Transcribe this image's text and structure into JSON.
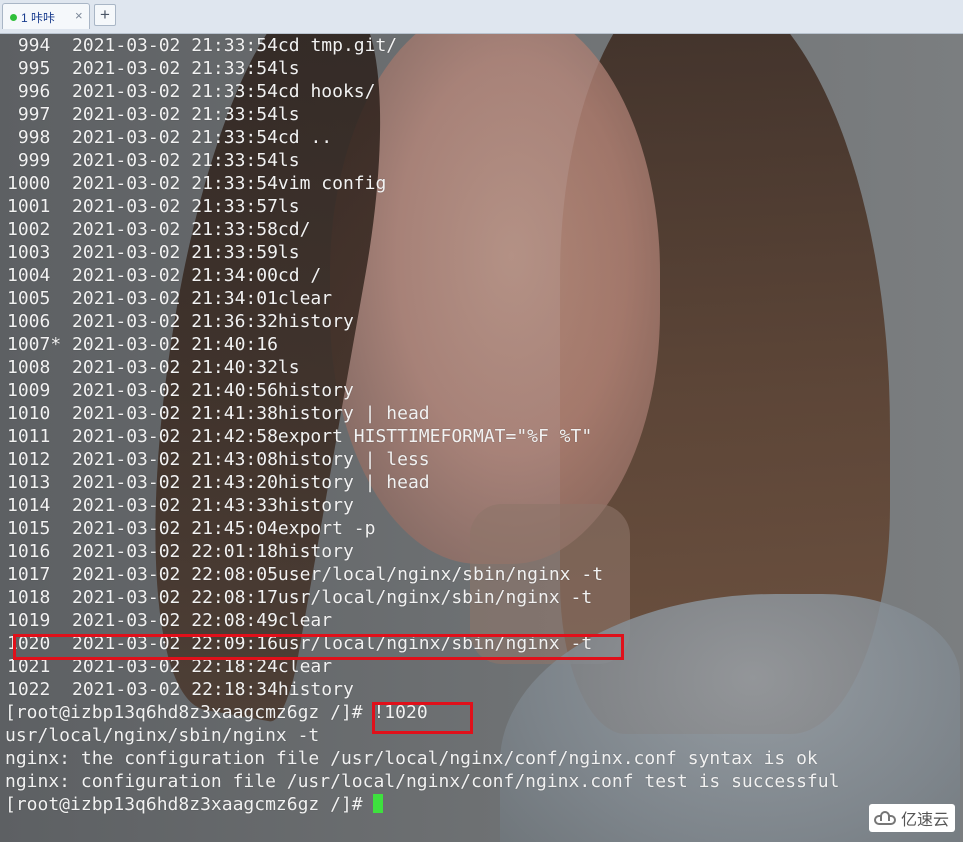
{
  "tab": {
    "label": "1 咔咔",
    "close": "×",
    "dot_color": "#2fbf3a"
  },
  "new_tab": "+",
  "history": [
    "994  2021-03-02 21:33:54cd tmp.git/",
    "995  2021-03-02 21:33:54ls",
    "996  2021-03-02 21:33:54cd hooks/",
    "997  2021-03-02 21:33:54ls",
    "998  2021-03-02 21:33:54cd ..",
    "999  2021-03-02 21:33:54ls",
    "1000  2021-03-02 21:33:54vim config",
    "1001  2021-03-02 21:33:57ls",
    "1002  2021-03-02 21:33:58cd/",
    "1003  2021-03-02 21:33:59ls",
    "1004  2021-03-02 21:34:00cd /",
    "1005  2021-03-02 21:34:01clear",
    "1006  2021-03-02 21:36:32history",
    "1007* 2021-03-02 21:40:16",
    "1008  2021-03-02 21:40:32ls",
    "1009  2021-03-02 21:40:56history",
    "1010  2021-03-02 21:41:38history | head",
    "1011  2021-03-02 21:42:58export HISTTIMEFORMAT=\"%F %T\"",
    "1012  2021-03-02 21:43:08history | less",
    "1013  2021-03-02 21:43:20history | head",
    "1014  2021-03-02 21:43:33history",
    "1015  2021-03-02 21:45:04export -p",
    "1016  2021-03-02 22:01:18history",
    "1017  2021-03-02 22:08:05user/local/nginx/sbin/nginx -t",
    "1018  2021-03-02 22:08:17usr/local/nginx/sbin/nginx -t",
    "1019  2021-03-02 22:08:49clear",
    "1020  2021-03-02 22:09:16usr/local/nginx/sbin/nginx -t",
    "1021  2021-03-02 22:18:24clear",
    "1022  2021-03-02 22:18:34history"
  ],
  "prompt": "[root@izbp13q6hd8z3xaagcmz6gz /]#",
  "command": "!1020",
  "output": [
    "usr/local/nginx/sbin/nginx -t",
    "nginx: the configuration file /usr/local/nginx/conf/nginx.conf syntax is ok",
    "nginx: configuration file /usr/local/nginx/conf/nginx.conf test is successful"
  ],
  "prompt2": "[root@izbp13q6hd8z3xaagcmz6gz /]#",
  "highlight_color": "#e0101a",
  "cursor_color": "#3ee03e",
  "watermark": "亿速云"
}
